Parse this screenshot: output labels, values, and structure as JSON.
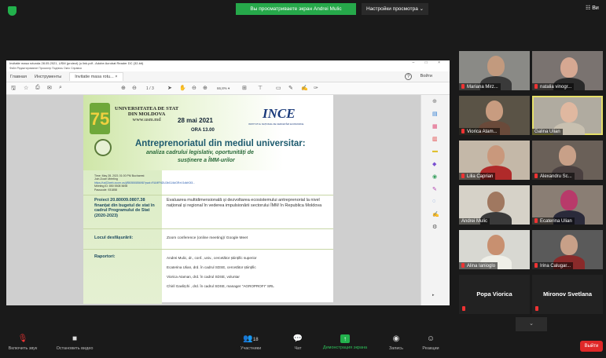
{
  "top_bar": {
    "banner": "Вы просматриваете экран Andrei Mulic",
    "view_options": "Настройки просмотра ⌄",
    "gallery_btn": "☷ Ви"
  },
  "acrobat": {
    "title": "Invitatie masa rotunda 28.05.2021, USM (proiect) (u link.pdf - Adobe Acrobat Reader DC (32-bit)",
    "menu": "Файл  Редактирование  Просмотр  Подпись  Окно  Справка",
    "tabs": [
      "Главная",
      "Инструменты",
      "Invitatie masa rotu... ×"
    ],
    "login": "Войти",
    "page_num": "1 / 3",
    "zoom": "66,8% ▾"
  },
  "pdf": {
    "univ": "UNIVERSITATEA DE STAT\nDIN MOLDOVA\nwww.usm.md",
    "date": "28 mai  2021",
    "ora": "ORA 13.00",
    "ince": "INCE",
    "ince_sub": "INSTITUTUL NAȚIONAL DE CERCETĂRI ECONOMICE",
    "headline": "Antreprenoriatul din mediul universitar:",
    "sub1": "analiza cadrului legislativ, oportunități de",
    "sub2": "susținere a ÎMM-urilor",
    "meeting_lines": [
      "Time: May 28, 2021 01:00 PM Bucharest",
      "Join Zoom Meeting"
    ],
    "meeting_link": "https://us02web.zoom.us/j/85055085698?pwd=RUMFNDU3bGJ4dGRxV1dkK0l3...",
    "meeting_lines2": [
      "Meeting ID: 850 5508 5698",
      "Passcode: 931858"
    ],
    "rows": [
      {
        "label": "Proiect 20.80009.0807.38 finanțat din bugetul de stat în cadrul Programului de Stat (2020-2023)",
        "value": "Evaluarea multidimensională și dezvoltarea ecosistemului antreprenorial la nivel național și regional în vederea impulsionării sectorului ÎMM în Republica Moldova"
      },
      {
        "label": "Locul desfășurării:",
        "value": "Zoom conference (online meeting)/ Google Meet"
      },
      {
        "label": "Raportori:",
        "value": ""
      }
    ],
    "speakers": [
      "Andrei Mulic, dr., conf., univ., cercetător științific superior",
      "Ecaterina Ulian, drd. în cadrul SDSE, cercetător științific",
      "Viorica Ataman, drd. în cadrul SDSE, voluntar",
      "Chiril Gavlițchi , drd. în cadrul SDSE, manager \"AGROPROFI\" SRL"
    ]
  },
  "participants": [
    {
      "name": "Mariana Mirz..."
    },
    {
      "name": "natalia vinogr..."
    },
    {
      "name": "Viorica Atam..."
    },
    {
      "name": "Galina Ulian"
    },
    {
      "name": "Lilia Caprian"
    },
    {
      "name": "Alexandru Sc..."
    },
    {
      "name": "Andrei Mulic"
    },
    {
      "name": "Ecaterina Ulian"
    },
    {
      "name": "Alina Ianioglo"
    },
    {
      "name": "Irina Calugar..."
    },
    {
      "name": "Popa Viorica"
    },
    {
      "name": "Mironov Svetlana"
    }
  ],
  "scroll_down": "⌄",
  "toolbar": {
    "unmute": "Включить звук",
    "start_video": "Остановить видео",
    "participants": "Участники",
    "participants_count": "18",
    "chat": "Чат",
    "share": "Демонстрация экрана",
    "record": "Запись",
    "reactions": "Реакции",
    "leave": "Выйти"
  },
  "colors": {
    "accent": "#26a84a",
    "leave": "#e02828",
    "active_border": "#e6e06a"
  }
}
